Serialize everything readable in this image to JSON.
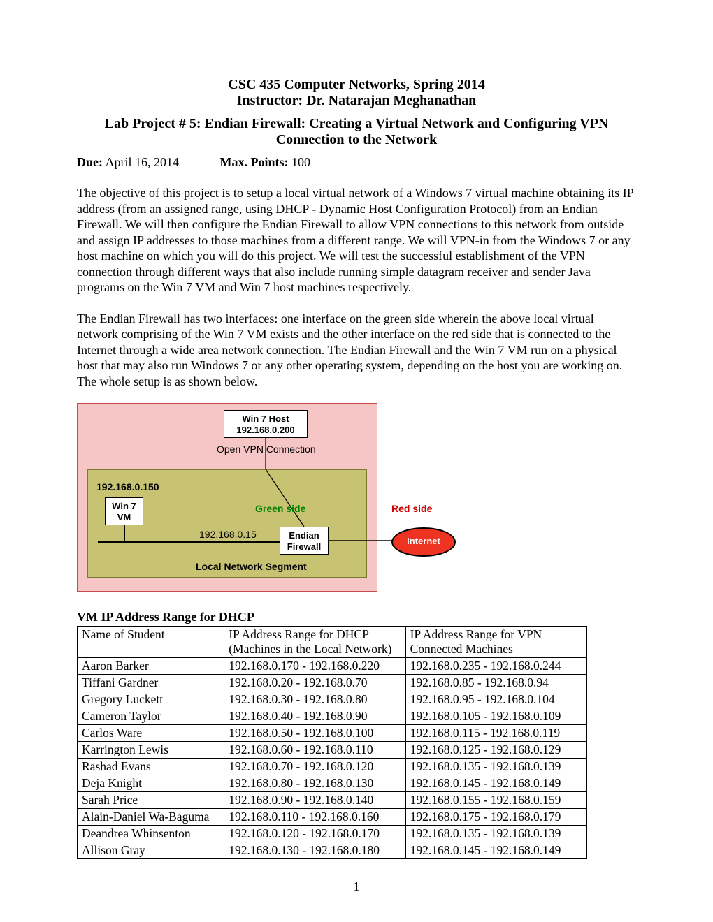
{
  "header": {
    "course": "CSC 435 Computer Networks, Spring 2014",
    "instructor": "Instructor: Dr. Natarajan Meghanathan",
    "lab_title": "Lab Project # 5: Endian Firewall: Creating a Virtual Network and Configuring VPN",
    "lab_subtitle": "Connection to the Network",
    "due_label": "Due:",
    "due_value": " April 16, 2014",
    "max_label": "Max. Points:",
    "max_value": " 100"
  },
  "paragraphs": {
    "p1": "The objective of this project is to setup a local virtual network of a Windows 7 virtual machine obtaining its IP address (from an assigned range, using DHCP - Dynamic Host Configuration Protocol) from an Endian Firewall. We will then configure the Endian Firewall to allow VPN connections to this network from outside and assign IP addresses to those machines from a different range. We will VPN-in from the Windows 7 or any host machine on which you will do this project. We will test the successful establishment of the VPN connection through different ways that also include running simple datagram receiver and sender Java programs on the Win 7 VM and Win 7 host machines respectively.",
    "p2": "The Endian Firewall has two interfaces: one interface on the green side wherein the above local virtual network comprising of the Win 7 VM exists and the other interface on the red side that is connected to the Internet through a wide area network connection. The Endian Firewall and the Win 7 VM run on a physical host that may also run Windows 7 or any other operating system, depending on the host you are working on. The whole setup is as shown below."
  },
  "diagram": {
    "host_name": "Win 7 Host",
    "host_ip": "192.168.0.200",
    "vpn_label": "Open VPN Connection",
    "vm_ip": "192.168.0.150",
    "vm_name_1": "Win 7",
    "vm_name_2": "VM",
    "greenside": "Green side",
    "redside": "Red side",
    "fw_name_1": "Endian",
    "fw_name_2": "Firewall",
    "fw_ip": "192.168.0.15",
    "localseg": "Local Network Segment",
    "internet": "Internet"
  },
  "table": {
    "title": "VM IP Address Range for DHCP",
    "headers": {
      "col1": "Name of Student",
      "col2a": "IP Address Range for DHCP",
      "col2b": "(Machines in the Local Network)",
      "col3a": "IP Address Range for VPN",
      "col3b": "Connected Machines"
    },
    "rows": [
      {
        "name": "Aaron Barker",
        "dhcp": "192.168.0.170 - 192.168.0.220",
        "vpn": "192.168.0.235 - 192.168.0.244"
      },
      {
        "name": "Tiffani Gardner",
        "dhcp": "192.168.0.20 - 192.168.0.70",
        "vpn": "192.168.0.85 - 192.168.0.94"
      },
      {
        "name": "Gregory Luckett",
        "dhcp": "192.168.0.30 - 192.168.0.80",
        "vpn": "192.168.0.95 - 192.168.0.104"
      },
      {
        "name": "Cameron Taylor",
        "dhcp": "192.168.0.40 - 192.168.0.90",
        "vpn": "192.168.0.105 - 192.168.0.109"
      },
      {
        "name": "Carlos Ware",
        "dhcp": "192.168.0.50 - 192.168.0.100",
        "vpn": "192.168.0.115 - 192.168.0.119"
      },
      {
        "name": "Karrington Lewis",
        "dhcp": "192.168.0.60 - 192.168.0.110",
        "vpn": "192.168.0.125 - 192.168.0.129"
      },
      {
        "name": "Rashad Evans",
        "dhcp": "192.168.0.70 - 192.168.0.120",
        "vpn": "192.168.0.135 - 192.168.0.139"
      },
      {
        "name": "Deja Knight",
        "dhcp": "192.168.0.80 - 192.168.0.130",
        "vpn": "192.168.0.145 - 192.168.0.149"
      },
      {
        "name": "Sarah Price",
        "dhcp": "192.168.0.90 - 192.168.0.140",
        "vpn": "192.168.0.155 - 192.168.0.159"
      },
      {
        "name": "Alain-Daniel Wa-Baguma",
        "dhcp": "192.168.0.110 - 192.168.0.160",
        "vpn": "192.168.0.175 - 192.168.0.179"
      },
      {
        "name": "Deandrea Whinsenton",
        "dhcp": "192.168.0.120 - 192.168.0.170",
        "vpn": "192.168.0.135 - 192.168.0.139"
      },
      {
        "name": "Allison Gray",
        "dhcp": "192.168.0.130 - 192.168.0.180",
        "vpn": "192.168.0.145 - 192.168.0.149"
      }
    ]
  },
  "page_number": "1"
}
